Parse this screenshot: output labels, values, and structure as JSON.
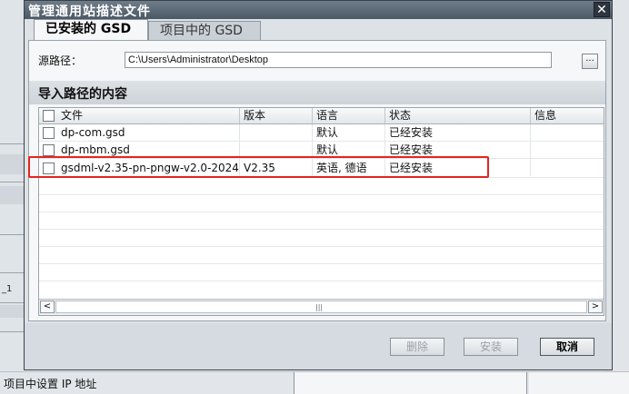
{
  "dialog": {
    "title": "管理通用站描述文件",
    "close": "✕",
    "tabs": [
      {
        "label": "已安装的 GSD",
        "active": true
      },
      {
        "label": "项目中的 GSD",
        "active": false
      }
    ],
    "source_label": "源路径：",
    "source_path": "C:\\Users\\Administrator\\Desktop",
    "browse": "...",
    "section_title": "导入路径的内容",
    "columns": [
      "文件",
      "版本",
      "语言",
      "状态",
      "信息"
    ],
    "rows": [
      {
        "file": "dp-com.gsd",
        "version": "",
        "language": "默认",
        "status": "已经安装",
        "info": ""
      },
      {
        "file": "dp-mbm.gsd",
        "version": "",
        "language": "默认",
        "status": "已经安装",
        "info": ""
      },
      {
        "file": "gsdml-v2.35-pn-pngw-v2.0-2024...",
        "version": "V2.35",
        "language": "英语, 德语",
        "status": "已经安装",
        "info": ""
      }
    ],
    "scroll_left": "<",
    "scroll_right": ">",
    "scroll_grip": "|||",
    "buttons": {
      "delete": "删除",
      "install": "安装",
      "cancel": "取消"
    }
  },
  "background": {
    "status_text": "项目中设置 IP 地址",
    "fragment": "_1"
  },
  "colors": {
    "highlight": "#e5251f",
    "title_bar": "#4b5865"
  }
}
